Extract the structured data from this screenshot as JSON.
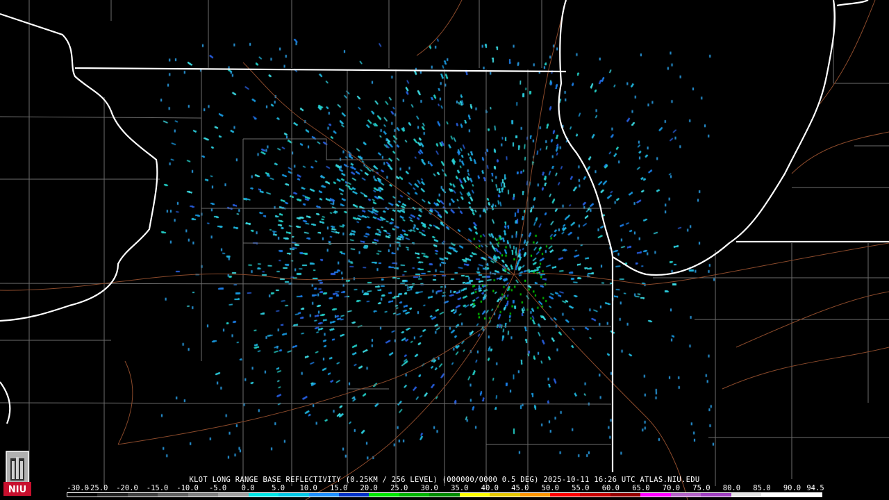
{
  "caption": "KLOT LONG RANGE BASE REFLECTIVITY (0.25KM / 256 LEVEL) (000000/0000 0.5 DEG) 2025-10-11 16:26 UTC  ATLAS.NIU.EDU",
  "logo": {
    "text": "NIU"
  },
  "scale": {
    "labels": [
      "-30.0",
      "-25.0",
      "-20.0",
      "-15.0",
      "-10.0",
      "-5.0",
      "0.0",
      "5.0",
      "10.0",
      "15.0",
      "20.0",
      "25.0",
      "30.0",
      "35.0",
      "40.0",
      "45.0",
      "50.0",
      "55.0",
      "60.0",
      "65.0",
      "70.0",
      "75.0",
      "80.0",
      "85.0",
      "90.0",
      "94.5"
    ],
    "colors": [
      "#000000",
      "#202020",
      "#404040",
      "#606060",
      "#808080",
      "#a0a0a0",
      "#00e6e6",
      "#00c8e6",
      "#1e90ff",
      "#0032c8",
      "#00e600",
      "#00b400",
      "#008c00",
      "#ffff00",
      "#e6c800",
      "#ff9600",
      "#ff0000",
      "#c80000",
      "#960000",
      "#ff00ff",
      "#b464c8",
      "#a040c0",
      "#e6e6e6",
      "#ffffff",
      "#ffffff"
    ]
  }
}
